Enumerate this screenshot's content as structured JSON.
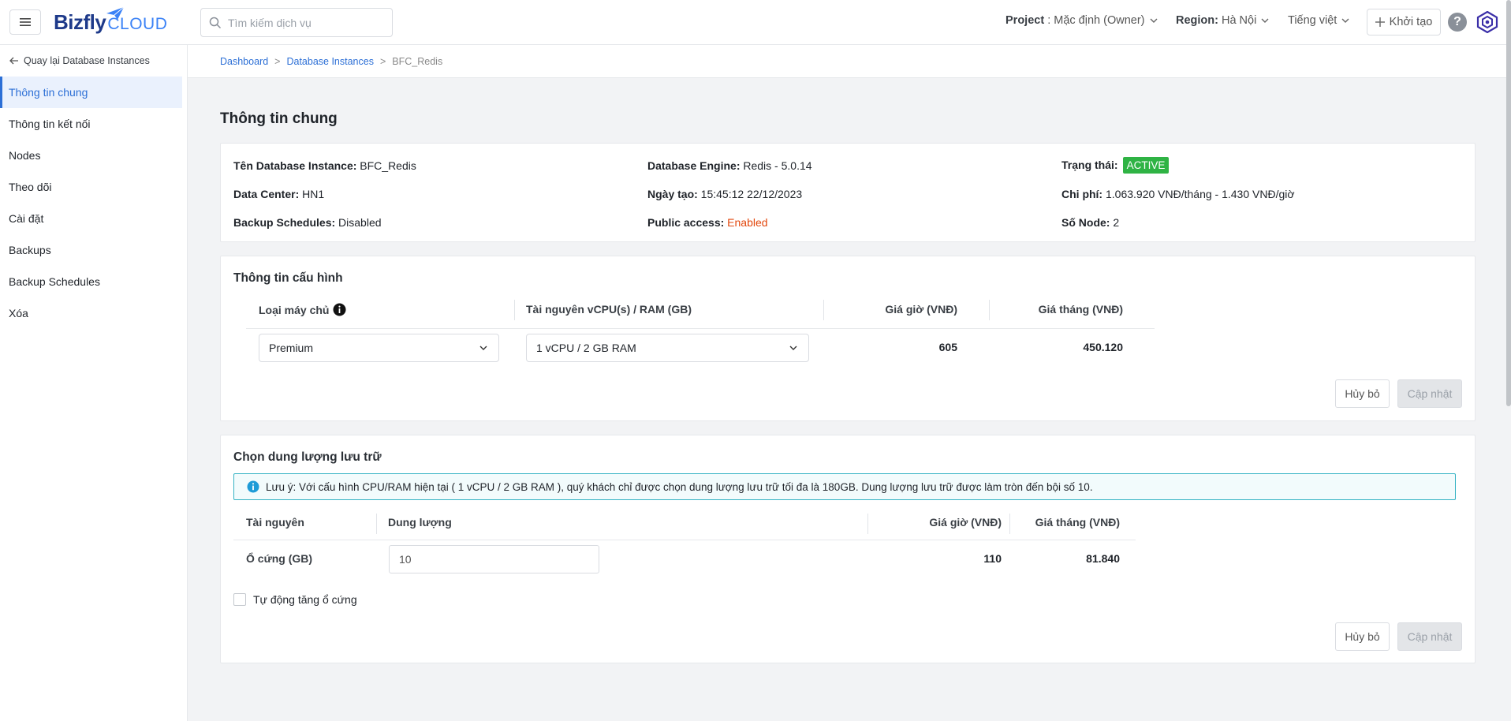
{
  "header": {
    "logo_text": "Bizfly",
    "logo_suffix": "CLOUD",
    "search_placeholder": "Tìm kiếm dịch vụ",
    "project_label": "Project",
    "project_value": " : Mặc định (Owner)",
    "region_label": "Region:",
    "region_value": " Hà Nội",
    "language": "Tiếng việt",
    "create_label": "Khởi tạo",
    "help_glyph": "?"
  },
  "sidebar": {
    "back_label": "Quay lại Database Instances",
    "items": [
      {
        "label": "Thông tin chung",
        "active": true
      },
      {
        "label": "Thông tin kết nối"
      },
      {
        "label": "Nodes"
      },
      {
        "label": "Theo dõi"
      },
      {
        "label": "Cài đặt"
      },
      {
        "label": "Backups"
      },
      {
        "label": "Backup Schedules"
      },
      {
        "label": "Xóa"
      }
    ]
  },
  "breadcrumb": {
    "items": [
      "Dashboard",
      "Database Instances",
      "BFC_Redis"
    ],
    "separator": ">"
  },
  "page_title": "Thông tin chung",
  "general": {
    "name_label": "Tên Database Instance:",
    "name_value": " BFC_Redis",
    "engine_label": "Database Engine:",
    "engine_value": " Redis - 5.0.14",
    "status_label": "Trạng thái:",
    "status_value": "ACTIVE",
    "datacenter_label": "Data Center:",
    "datacenter_value": " HN1",
    "created_label": "Ngày tạo:",
    "created_value": " 15:45:12 22/12/2023",
    "cost_label": "Chi phí:",
    "cost_value": " 1.063.920 VNĐ/tháng - 1.430 VNĐ/giờ",
    "backup_label": "Backup Schedules:",
    "backup_value": " Disabled",
    "public_label": "Public access:",
    "public_value": " Enabled",
    "nodes_label": "Số Node:",
    "nodes_value": " 2"
  },
  "config": {
    "title": "Thông tin cấu hình",
    "col_server_type": "Loại máy chủ",
    "col_resource": "Tài nguyên vCPU(s) / RAM (GB)",
    "col_hourly": "Giá giờ (VNĐ)",
    "col_monthly": "Giá tháng (VNĐ)",
    "server_type_value": "Premium",
    "resource_value": "1 vCPU / 2 GB RAM",
    "hourly_value": "605",
    "monthly_value": "450.120",
    "cancel_label": "Hủy bỏ",
    "update_label": "Cập nhật"
  },
  "storage": {
    "title": "Chọn dung lượng lưu trữ",
    "note": "Lưu ý: Với cấu hình CPU/RAM hiện tại ( 1 vCPU / 2 GB RAM ), quý khách chỉ được chọn dung lượng lưu trữ tối đa là 180GB. Dung lượng lưu trữ được làm tròn đến bội số 10.",
    "col_resource": "Tài nguyên",
    "col_capacity": "Dung lượng",
    "col_hourly": "Giá giờ (VNĐ)",
    "col_monthly": "Giá tháng (VNĐ)",
    "row_label": "Ổ cứng (GB)",
    "capacity_value": "10",
    "hourly_value": "110",
    "monthly_value": "81.840",
    "auto_increase_label": "Tự động tăng ổ cứng",
    "auto_increase_checked": false,
    "cancel_label": "Hủy bỏ",
    "update_label": "Cập nhật"
  },
  "colors": {
    "accent": "#2c6fd6",
    "active_badge": "#2fb344",
    "enabled_text": "#e2470d",
    "note_border": "#35b3c4"
  }
}
